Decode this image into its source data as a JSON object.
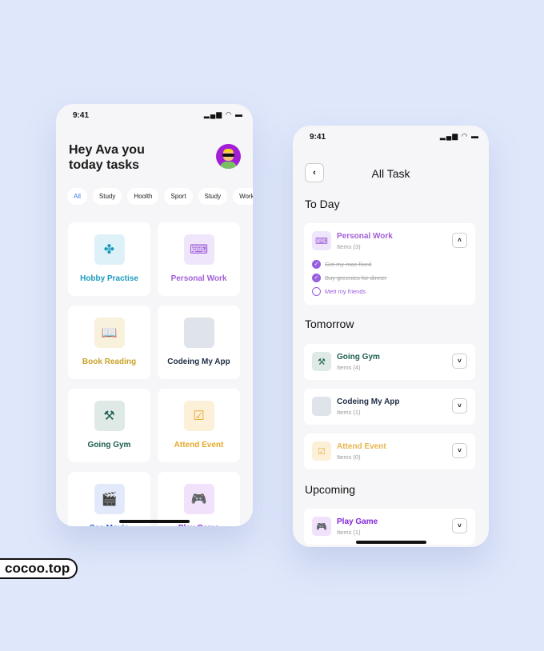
{
  "left": {
    "time": "9:41",
    "status": "▂▄▆ ◠ ▬",
    "greeting_line1": "Hey Ava you",
    "greeting_line2": "today tasks",
    "chips": [
      "All",
      "Study",
      "Hoolth",
      "Sport",
      "Study",
      "Work"
    ],
    "cards": [
      {
        "label": "Hobby Practise",
        "icon": "puzzle-icon",
        "glyph": "✤",
        "color": "#1b9bbd",
        "bg": "#dff1f8"
      },
      {
        "label": "Personal Work",
        "icon": "person-desk-icon",
        "glyph": "⌨",
        "color": "#a15fd8",
        "bg": "#efe6fb"
      },
      {
        "label": "Book Reading",
        "icon": "reading-icon",
        "glyph": "📖",
        "color": "#c8a32a",
        "bg": "#f8f1dc"
      },
      {
        "label": "Codeing My App",
        "icon": "code-icon",
        "glyph": "</>",
        "color": "#1f2d45",
        "bg": "#dfe3ea"
      },
      {
        "label": "Going Gym",
        "icon": "dumbbell-icon",
        "glyph": "⚒",
        "color": "#1d5e50",
        "bg": "#dfeae7"
      },
      {
        "label": "Attend Event",
        "icon": "calendar-icon",
        "glyph": "☑",
        "color": "#e7a92b",
        "bg": "#fcf0d8"
      },
      {
        "label": "See Movie",
        "icon": "clapperboard-icon",
        "glyph": "🎬",
        "color": "#2457d6",
        "bg": "#e1e9fb"
      },
      {
        "label": "Play Game",
        "icon": "gamepad-icon",
        "glyph": "🎮",
        "color": "#8226d9",
        "bg": "#f1e1fb"
      }
    ]
  },
  "right": {
    "time": "9:41",
    "status": "▂▄▆ ◠ ▬",
    "back": "‹",
    "title": "All Task",
    "today": "To Day",
    "tomorrow": "Tomorrow",
    "upcoming": "Upcoming",
    "personal": {
      "name": "Personal Work",
      "count": "Items (3)",
      "toggle": "˄",
      "color": "#a15fd8",
      "subtasks": [
        {
          "text": "Got my mac fixed",
          "done": true
        },
        {
          "text": "Buy greenies for dinner",
          "done": true
        },
        {
          "text": "Mett my friends",
          "done": false
        }
      ]
    },
    "tomorrow_items": [
      {
        "name": "Going Gym",
        "count": "Items (4)",
        "glyph": "⚒",
        "icon": "dumbbell-icon",
        "color": "#1d5e50",
        "bg": "#dfeae7"
      },
      {
        "name": "Codeing My App",
        "count": "Items (1)",
        "glyph": "</>",
        "icon": "code-icon",
        "color": "#1f2d45",
        "bg": "#dfe3ea"
      },
      {
        "name": "Attend Event",
        "count": "Items (0)",
        "glyph": "☑",
        "icon": "calendar-icon",
        "color": "#e7b54b",
        "bg": "#fcf0d8"
      }
    ],
    "upcoming_items": [
      {
        "name": "Play  Game",
        "count": "Items (1)",
        "glyph": "🎮",
        "icon": "gamepad-icon",
        "color": "#8226d9",
        "bg": "#f1e1fb"
      }
    ],
    "expand": "˅"
  },
  "watermark": "cocoo.top"
}
